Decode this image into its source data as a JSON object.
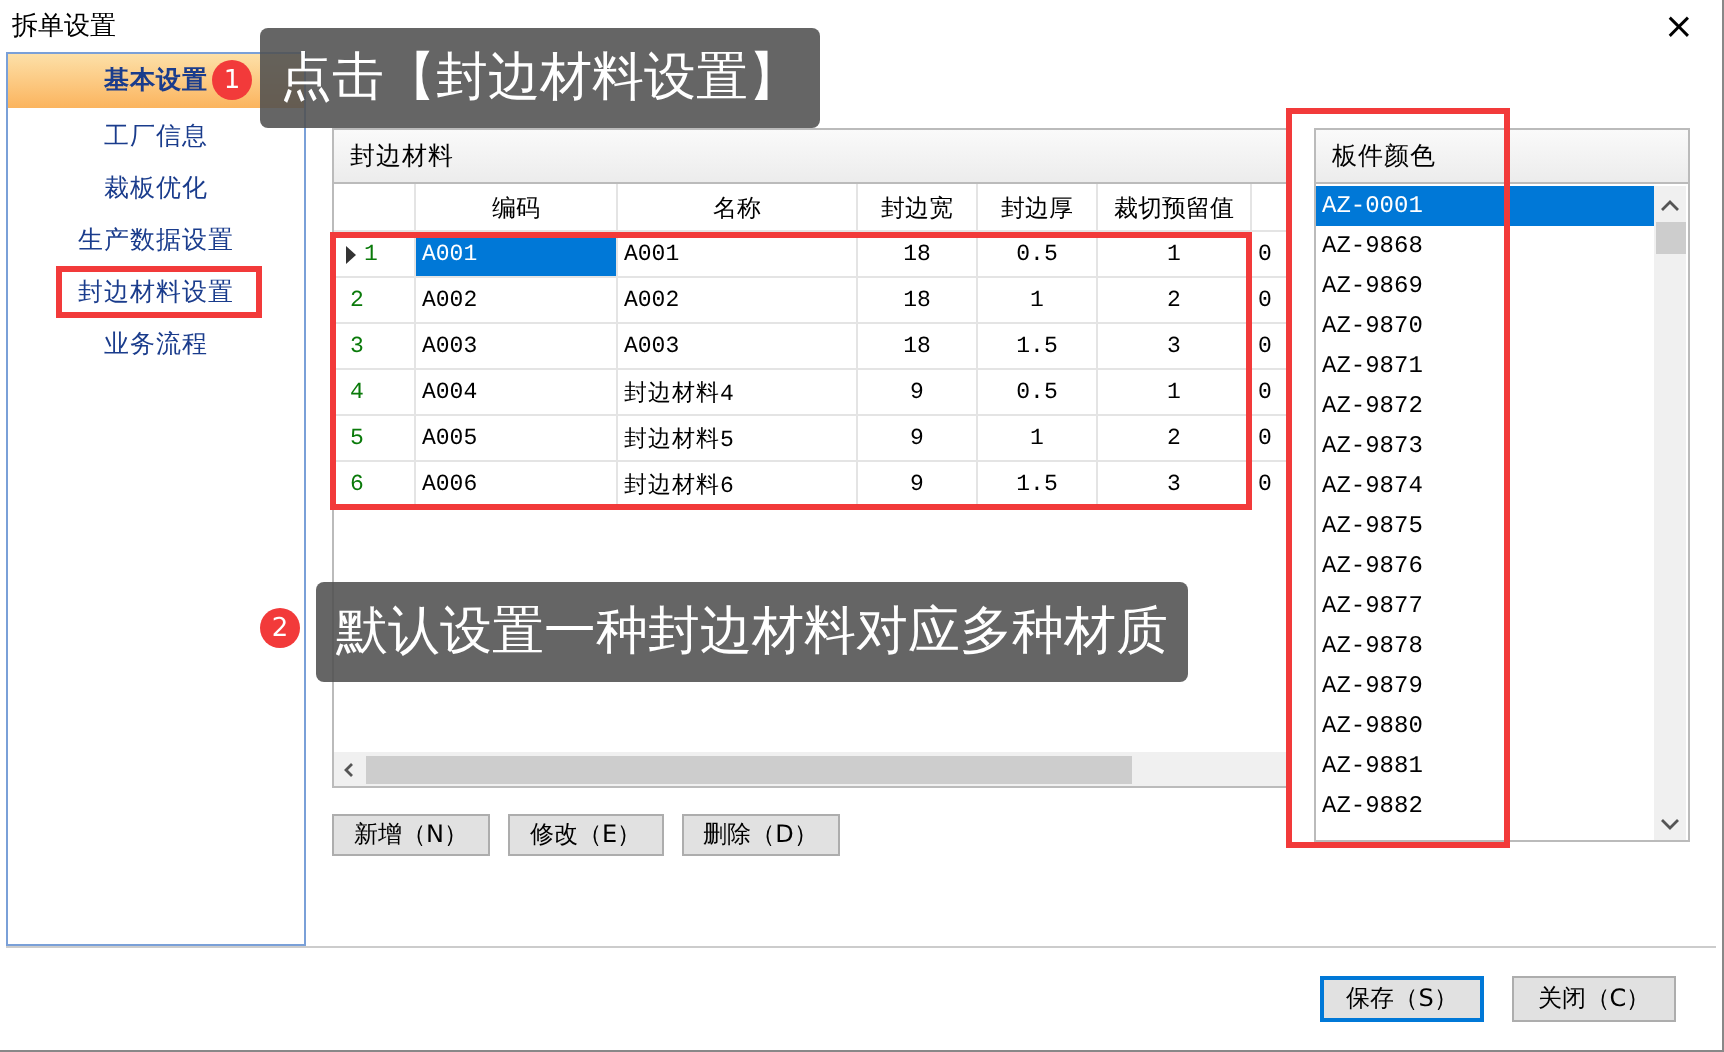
{
  "window": {
    "title": "拆单设置",
    "close": "×"
  },
  "sidebar": {
    "items": [
      {
        "label": "基本设置",
        "selected": true
      },
      {
        "label": "工厂信息",
        "selected": false
      },
      {
        "label": "裁板优化",
        "selected": false
      },
      {
        "label": "生产数据设置",
        "selected": false
      },
      {
        "label": "封边材料设置",
        "selected": false
      },
      {
        "label": "业务流程",
        "selected": false
      }
    ]
  },
  "edge_materials": {
    "title": "封边材料",
    "columns": [
      "编码",
      "名称",
      "封边宽",
      "封边厚",
      "裁切预留值"
    ],
    "rows": [
      {
        "index": "1",
        "selected": true,
        "cells": [
          "A001",
          "A001",
          "18",
          "0.5",
          "1",
          "0"
        ]
      },
      {
        "index": "2",
        "selected": false,
        "cells": [
          "A002",
          "A002",
          "18",
          "1",
          "2",
          "0"
        ]
      },
      {
        "index": "3",
        "selected": false,
        "cells": [
          "A003",
          "A003",
          "18",
          "1.5",
          "3",
          "0"
        ]
      },
      {
        "index": "4",
        "selected": false,
        "cells": [
          "A004",
          "封边材料4",
          "9",
          "0.5",
          "1",
          "0"
        ]
      },
      {
        "index": "5",
        "selected": false,
        "cells": [
          "A005",
          "封边材料5",
          "9",
          "1",
          "2",
          "0"
        ]
      },
      {
        "index": "6",
        "selected": false,
        "cells": [
          "A006",
          "封边材料6",
          "9",
          "1.5",
          "3",
          "0"
        ]
      }
    ],
    "buttons": [
      "新增（N）",
      "修改（E）",
      "删除（D）"
    ]
  },
  "board_colors": {
    "title": "板件颜色",
    "items": [
      {
        "label": "AZ-0001",
        "selected": true
      },
      {
        "label": "AZ-9868",
        "selected": false
      },
      {
        "label": "AZ-9869",
        "selected": false
      },
      {
        "label": "AZ-9870",
        "selected": false
      },
      {
        "label": "AZ-9871",
        "selected": false
      },
      {
        "label": "AZ-9872",
        "selected": false
      },
      {
        "label": "AZ-9873",
        "selected": false
      },
      {
        "label": "AZ-9874",
        "selected": false
      },
      {
        "label": "AZ-9875",
        "selected": false
      },
      {
        "label": "AZ-9876",
        "selected": false
      },
      {
        "label": "AZ-9877",
        "selected": false
      },
      {
        "label": "AZ-9878",
        "selected": false
      },
      {
        "label": "AZ-9879",
        "selected": false
      },
      {
        "label": "AZ-9880",
        "selected": false
      },
      {
        "label": "AZ-9881",
        "selected": false
      },
      {
        "label": "AZ-9882",
        "selected": false
      }
    ]
  },
  "footer_buttons": [
    {
      "label": "保存（S）",
      "default": true
    },
    {
      "label": "关闭（C）",
      "default": false
    }
  ],
  "annotations": [
    {
      "kind": "callout",
      "badge": "1",
      "text": "点击【封边材料设置】"
    },
    {
      "kind": "callout",
      "badge": "2",
      "text": "默认设置一种封边材料对应多种材质"
    }
  ]
}
